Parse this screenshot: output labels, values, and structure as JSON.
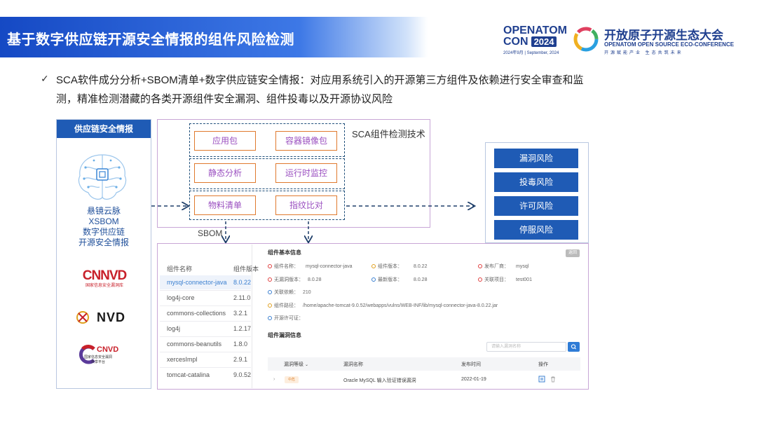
{
  "header": {
    "title": "基于数字供应链开源安全情报的组件风险检测"
  },
  "logo": {
    "openatom": "OPENATOM",
    "con": "CON",
    "year": "2024",
    "date": "2024年9月 | September, 2024",
    "cn": "开放原子开源生态大会",
    "en": "OPENATOM OPEN SOURCE ECO-CONFERENCE",
    "slogan": "开源赋能产业  生态共筑未来"
  },
  "bullet": {
    "text": "SCA软件成分分析+SBOM清单+数字供应链安全情报：对应用系统引入的开源第三方组件及依赖进行安全审查和监测，精准检测潜藏的各类开源组件安全漏洞、组件投毒以及开源协议风险"
  },
  "intel_panel": {
    "header": "供应链安全情报",
    "lines": [
      "悬镜云脉",
      "XSBOM",
      "数字供应链",
      "开源安全情报"
    ],
    "sources": {
      "cnnvd": "CNNVD",
      "cnnvd_cn": "国家信息安全漏洞库",
      "nvd": "NVD",
      "cnvd": "CNVD",
      "cnvd_cn1": "国家信息安全漏洞",
      "cnvd_cn2": "共享平台"
    }
  },
  "sca": {
    "title": "SCA组件检测技术",
    "items": [
      "应用包",
      "容器镜像包",
      "静态分析",
      "运行时监控",
      "物料清单",
      "指纹比对"
    ],
    "sbom_label": "SBOM"
  },
  "risks": [
    "漏洞风险",
    "投毒风险",
    "许可风险",
    "停服风险"
  ],
  "component_list": {
    "headers": {
      "name": "组件名称",
      "version": "组件版本"
    },
    "rows": [
      {
        "name": "mysql-connector-java",
        "version": "8.0.22"
      },
      {
        "name": "log4j-core",
        "version": "2.11.0"
      },
      {
        "name": "commons-collections",
        "version": "3.2.1"
      },
      {
        "name": "log4j",
        "version": "1.2.17"
      },
      {
        "name": "commons-beanutils",
        "version": "1.8.0"
      },
      {
        "name": "xercesImpl",
        "version": "2.9.1"
      },
      {
        "name": "tomcat-catalina",
        "version": "9.0.52"
      }
    ]
  },
  "detail": {
    "basic_title": "组件基本信息",
    "close_label": "返回",
    "fields": {
      "name_label": "组件名称：",
      "name_value": "mysql-connector-java",
      "version_label": "组件版本：",
      "version_value": "8.0.22",
      "vendor_label": "发布厂商：",
      "vendor_value": "mysql",
      "recommend_label": "无漏洞版本：",
      "recommend_value": "8.0.28",
      "latest_label": "最新版本：",
      "latest_value": "8.0.28",
      "project_label": "关联项目：",
      "project_value": "test001",
      "deps_label": "关联依赖：",
      "deps_value": "210",
      "path_label": "组件路径：",
      "path_value": "/home/apache-tomcat-9.0.52/webapps/vulns/WEB-INF/lib/mysql-connector-java-8.0.22.jar",
      "license_label": "开源许可证："
    },
    "vuln_title": "组件漏洞信息",
    "search_placeholder": "请输入漏洞名称",
    "vuln_headers": {
      "level": "漏洞等级",
      "name": "漏洞名称",
      "time": "发布时间",
      "action": "操作"
    },
    "vuln_row": {
      "level": "中危",
      "name": "Oracle MySQL 输入验证错误漏洞",
      "time": "2022-01-19"
    }
  },
  "colors": {
    "header_blue": "#1549c4",
    "risk_blue": "#1f5bb5",
    "item_orange": "#e07a2e",
    "item_text": "#9a4fc0"
  }
}
